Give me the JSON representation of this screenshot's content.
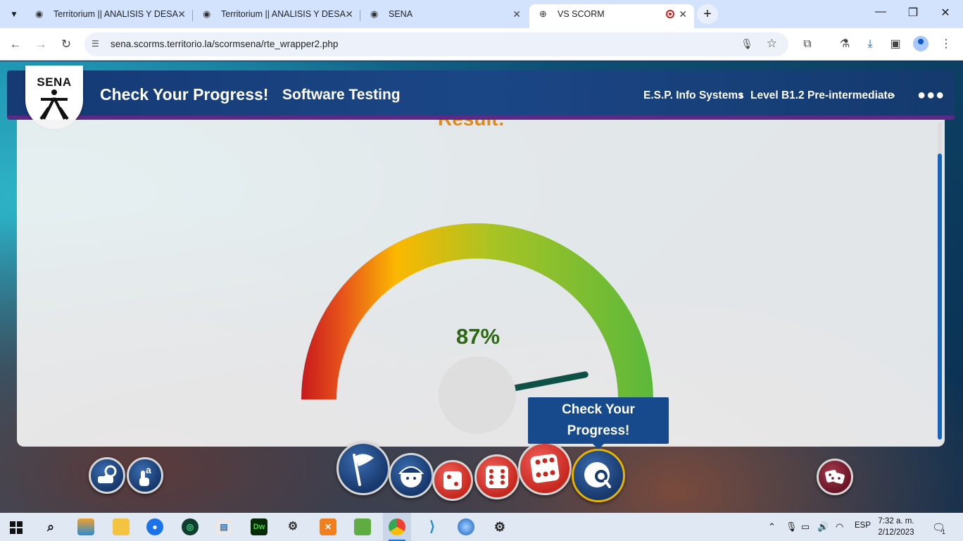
{
  "browser": {
    "tabs": [
      {
        "title": "Territorium || ANALISIS Y DESA",
        "active": false
      },
      {
        "title": "Territorium || ANALISIS Y DESA",
        "active": false
      },
      {
        "title": "SENA",
        "active": false
      },
      {
        "title": "VS SCORM",
        "active": true
      }
    ],
    "url": "sena.scorms.territorio.la/scormsena/rte_wrapper2.php"
  },
  "header": {
    "logo_text": "SENA",
    "title": "Check Your Progress!",
    "subtitle": "Software Testing",
    "breadcrumb": [
      "E.S.P. Info Systems",
      "Level B1.2 Pre-intermediate"
    ]
  },
  "content": {
    "result_label": "Result:",
    "score_text": "87%",
    "score_fraction": 0.87
  },
  "tooltip": {
    "line1": "Check Your",
    "line2": "Progress!"
  },
  "taskbar": {
    "language": "ESP",
    "time": "7:32 a. m.",
    "date": "2/12/2023",
    "notification_count": "1"
  },
  "colors": {
    "banner": "#1b4686",
    "banner_stripe": "#5b2a86",
    "result_orange": "#e28a17",
    "score_green": "#2c6a12",
    "needle": "#0e5147",
    "tooltip_bg": "#174a8c"
  }
}
